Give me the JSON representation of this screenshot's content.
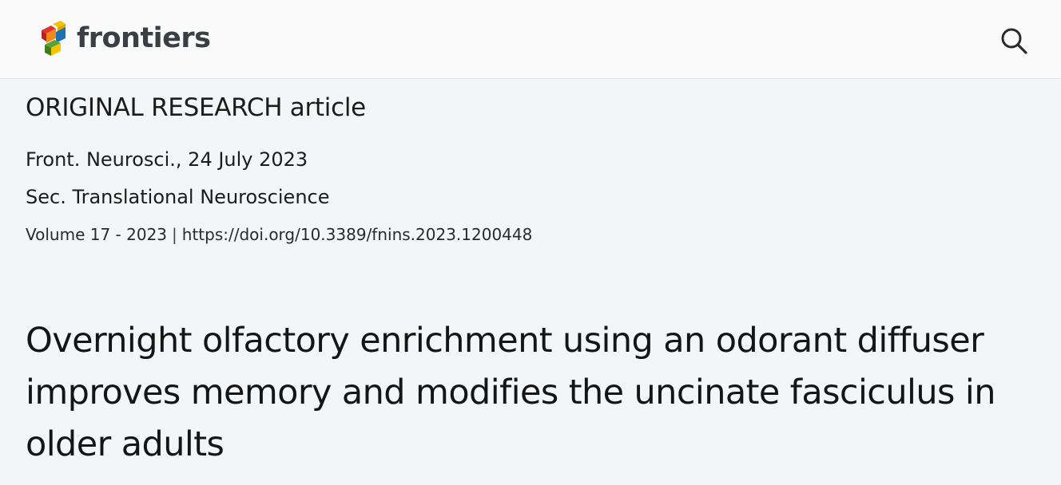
{
  "header": {
    "brand_name": "frontiers",
    "logo_colors": [
      "#e4332c",
      "#f7c200",
      "#1f6fb5",
      "#5aa132",
      "#f08a1c"
    ],
    "search_icon": "search-icon"
  },
  "article": {
    "article_type": "ORIGINAL RESEARCH article",
    "journal_line": "Front. Neurosci., 24 July 2023",
    "section": "Sec. Translational Neuroscience",
    "volume": "Volume 17 - 2023",
    "separator": "|",
    "doi": "https://doi.org/10.3389/fnins.2023.1200448",
    "title": "Overnight olfactory enrichment using an odorant diffuser improves memory and modifies the uncinate fasciculus in older adults"
  }
}
